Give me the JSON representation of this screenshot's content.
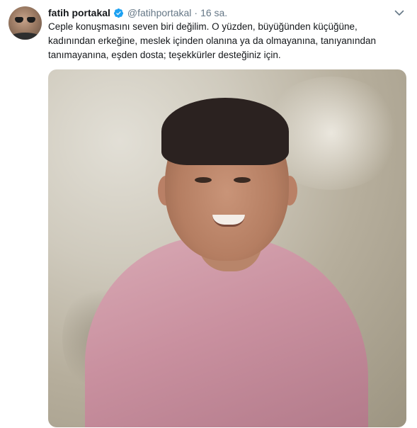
{
  "tweet": {
    "author_name": "fatih portakal",
    "handle": "@fatihportakal",
    "separator": "·",
    "time": "16 sa.",
    "text_lines": [
      "Ceple konuşmasını seven biri değilim. O yüzden, büyüğünden küçüğüne,",
      "kadınından erkeğine, meslek içinden olanına ya da olmayanına, tanıyanından",
      "tanımayanına, eşden dosta; teşekkürler desteğiniz için."
    ],
    "media_subject": "photo of smiling man in pink shirt"
  },
  "colors": {
    "verified_blue": "#1da1f2",
    "secondary_text": "#657786",
    "primary_text": "#14171a"
  },
  "icons": {
    "verified": "verified-badge-icon",
    "menu": "chevron-down-icon"
  }
}
